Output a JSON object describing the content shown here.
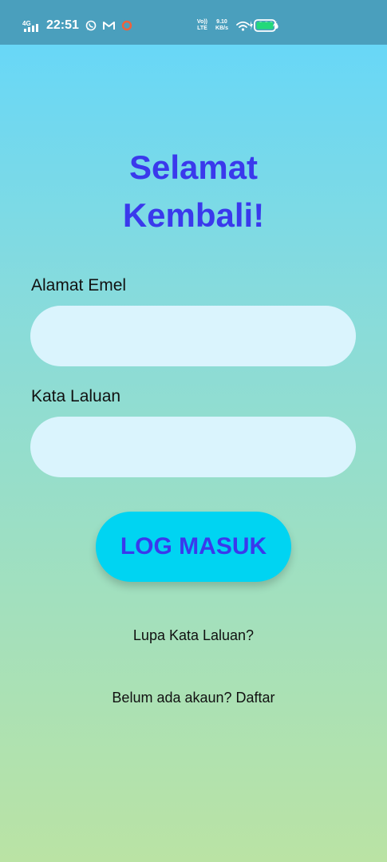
{
  "status_bar": {
    "network_type": "4G",
    "time": "22:51",
    "volte_top": "Vo))",
    "volte_bottom": "LTE",
    "speed_value": "9.10",
    "speed_unit": "KB/s",
    "battery_percent": "99%",
    "battery_color": "#23d97a",
    "icons": [
      "signal-icon",
      "whatsapp-icon",
      "gmail-icon",
      "app-ring-icon",
      "wifi-icon",
      "charging-icon",
      "battery-icon"
    ]
  },
  "theme": {
    "accent": "#3a39ec",
    "button": "#00d4f2",
    "input_bg": "#daf4fd"
  },
  "login": {
    "title_line1": "Selamat",
    "title_line2": "Kembali!",
    "email_label": "Alamat Emel",
    "email_value": "",
    "password_label": "Kata Laluan",
    "password_value": "",
    "login_button": "LOG MASUK",
    "forgot_password": "Lupa Kata Laluan?",
    "register_prompt": "Belum ada akaun? Daftar"
  }
}
